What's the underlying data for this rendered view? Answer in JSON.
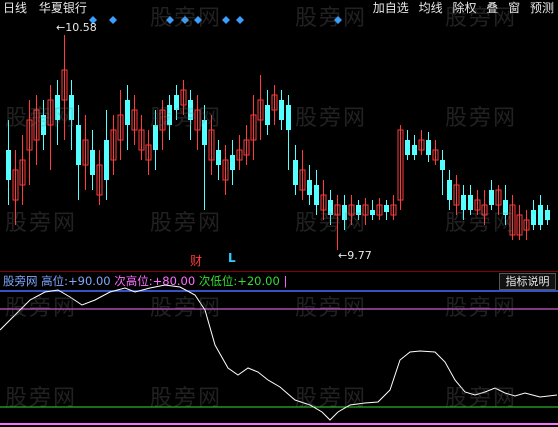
{
  "toolbar": {
    "left": [
      "日线",
      "华夏银行"
    ],
    "right": [
      "加自选",
      "均线",
      "除权",
      "叠",
      "窗",
      "预测"
    ]
  },
  "price_chart": {
    "high_label": "10.58",
    "low_label": "9.77",
    "finance_marker": "财",
    "l_marker": "L",
    "colors": {
      "up": "#ff3b3b",
      "down": "#54ffff",
      "diamond": "#3aa0ff"
    }
  },
  "indicator": {
    "name": "股旁网",
    "items": [
      {
        "label": "高位:",
        "value": "+90.00"
      },
      {
        "label": "次高位:",
        "value": "+80.00"
      },
      {
        "label": "次低位:",
        "value": "+20.00"
      }
    ],
    "end_mark": "|",
    "help_button": "指标说明",
    "lines": {
      "high": 90,
      "second_high": 80,
      "second_low": 20,
      "bottom": 0
    },
    "colors": {
      "high": "#4a6cff",
      "second_high": "#ff70ff",
      "second_low": "#33dd33",
      "bottom": "#ff70ff",
      "curve": "#ffffff"
    }
  },
  "watermark": "股旁网"
}
